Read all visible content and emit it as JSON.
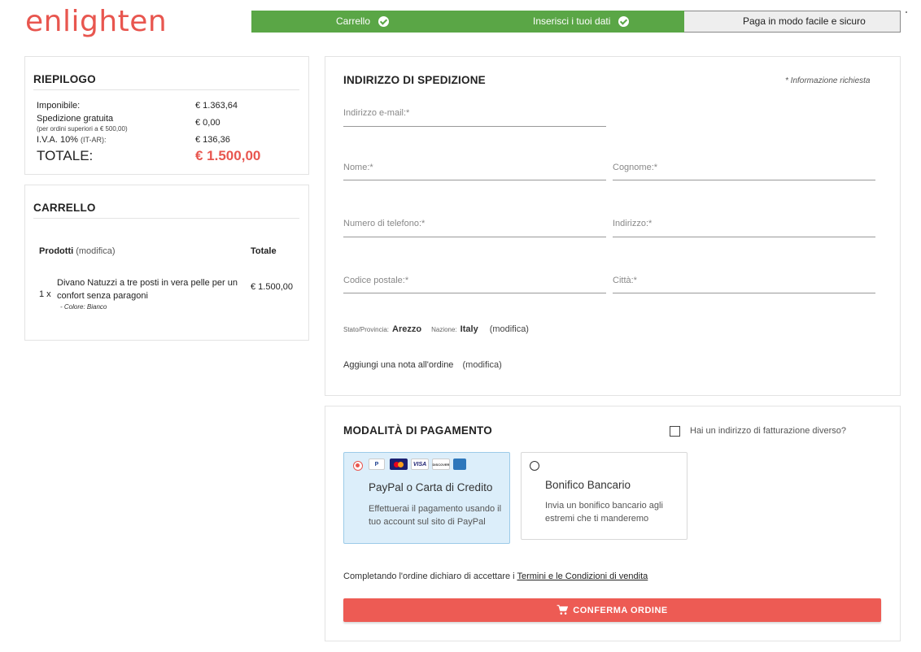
{
  "brand": {
    "logo_text": "enlighten",
    "accent": "#e8564f",
    "green": "#5aa646"
  },
  "steps": [
    {
      "label": "Carrello",
      "done": true
    },
    {
      "label": "Inserisci i tuoi dati",
      "done": true
    },
    {
      "label": "Paga in modo facile e sicuro",
      "done": false
    }
  ],
  "summary": {
    "title": "RIEPILOGO",
    "taxable_label": "Imponibile:",
    "taxable_value": "€ 1.363,64",
    "shipping_label": "Spedizione gratuita",
    "shipping_note": "(per ordini superiori a € 500,00)",
    "shipping_value": "€ 0,00",
    "vat_label": "I.V.A. 10%",
    "vat_note": "(IT-AR):",
    "vat_value": "€ 136,36",
    "total_label": "TOTALE:",
    "total_value": "€ 1.500,00"
  },
  "cart": {
    "title": "CARRELLO",
    "col_products": "Prodotti",
    "modify": "(modifica)",
    "col_total": "Totale",
    "items": [
      {
        "qty": "1 x",
        "name_line1": "Divano Natuzzi a tre posti in vera pelle per un",
        "name_line2": "confort senza paragoni",
        "variant": "- Colore: Bianco",
        "total": "€ 1.500,00"
      }
    ]
  },
  "shipping": {
    "title": "INDIRIZZO DI SPEDIZIONE",
    "required_note": "* Informazione richiesta",
    "email_label": "Indirizzo e-mail:*",
    "first_name_label": "Nome:*",
    "last_name_label": "Cognome:*",
    "phone_label": "Numero di telefono:*",
    "address_label": "Indirizzo:*",
    "zip_label": "Codice postale:*",
    "city_label": "Città:*",
    "province_label": "Stato/Provincia:",
    "province_value": "Arezzo",
    "country_label": "Nazione:",
    "country_value": "Italy",
    "location_modify": "(modifica)",
    "note_label": "Aggiungi una nota all'ordine",
    "note_modify": "(modifica)"
  },
  "payment": {
    "title": "MODALITÀ DI PAGAMENTO",
    "billing_checkbox_label": "Hai un indirizzo di fatturazione diverso?",
    "options": [
      {
        "title": "PayPal o Carta di Credito",
        "desc_line1": "Effettuerai il pagamento usando il",
        "desc_line2": "tuo account sul sito di PayPal",
        "selected": true
      },
      {
        "title": "Bonifico Bancario",
        "desc_line1": "Invia un bonifico bancario agli",
        "desc_line2": "estremi che ti manderemo",
        "selected": false
      }
    ],
    "card_logos": {
      "paypal": "P",
      "visa": "VISA",
      "discover": "DISCOVER"
    },
    "terms_prefix": "Completando l'ordine dichiaro di accettare i",
    "terms_link": "Termini e le Condizioni di vendita",
    "confirm_label": "CONFERMA ORDINE"
  }
}
